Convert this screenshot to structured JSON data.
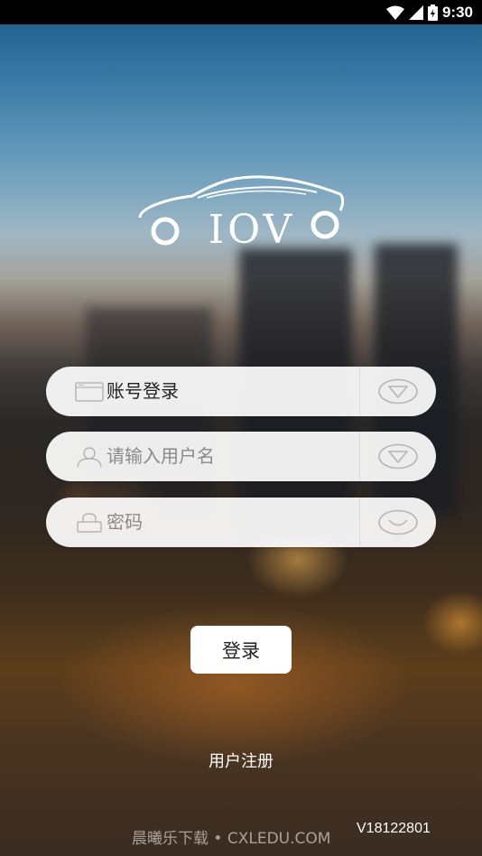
{
  "status_bar": {
    "time": "9:30",
    "icons": [
      "wifi-icon",
      "signal-icon",
      "battery-icon"
    ]
  },
  "logo": {
    "text": "IOV"
  },
  "login_form": {
    "account_type": {
      "value": "账号登录",
      "icon": "card-icon",
      "dropdown_icon": "chevron-down-icon"
    },
    "username": {
      "placeholder": "请输入用户名",
      "icon": "user-icon",
      "dropdown_icon": "chevron-down-icon"
    },
    "password": {
      "placeholder": "密码",
      "icon": "lock-icon",
      "toggle_icon": "eye-closed-icon"
    },
    "login_label": "登录"
  },
  "register_label": "用户注册",
  "watermark": "晨曦乐下载 • CXLEDU.COM",
  "version": "V18122801",
  "colors": {
    "field_background": "#ffffff",
    "text_primary": "#222222",
    "placeholder": "#8a8a8a",
    "icon_gray": "#b5b5b5"
  }
}
